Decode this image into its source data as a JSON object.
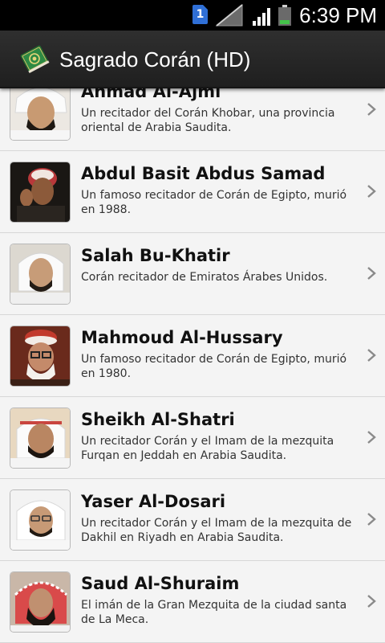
{
  "status_bar": {
    "sim_label": "1",
    "time": "6:39 PM"
  },
  "app_bar": {
    "title": "Sagrado Corán (HD)",
    "icon": "quran-book-icon"
  },
  "reciters": [
    {
      "name": "Ahmad Al-Ajmi",
      "description": "Un recitador del Corán Khobar, una provincia oriental de Arabia Saudita.",
      "avatar": "reciter-photo"
    },
    {
      "name": "Abdul Basit Abdus Samad",
      "description": "Un famoso recitador de Corán de Egipto, murió en 1988.",
      "avatar": "reciter-photo"
    },
    {
      "name": "Salah Bu-Khatir",
      "description": "Corán recitador de Emiratos Árabes Unidos.",
      "avatar": "reciter-photo"
    },
    {
      "name": "Mahmoud Al-Hussary",
      "description": "Un famoso recitador de Corán de Egipto, murió en 1980.",
      "avatar": "reciter-photo"
    },
    {
      "name": "Sheikh Al-Shatri",
      "description": "Un recitador Corán y el Imam de la mezquita Furqan en Jeddah en Arabia Saudita.",
      "avatar": "reciter-photo"
    },
    {
      "name": "Yaser Al-Dosari",
      "description": "Un recitador Corán y el Imam de la mezquita de Dakhil en Riyadh en Arabia Saudita.",
      "avatar": "reciter-photo"
    },
    {
      "name": "Saud Al-Shuraim",
      "description": "El imán de la Gran Mezquita de la ciudad santa de La Meca.",
      "avatar": "reciter-photo"
    }
  ],
  "colors": {
    "status_bar": "#000000",
    "action_bar": "#262626",
    "list_background": "#f4f4f4",
    "divider": "#d7d7d7",
    "chevron": "#8a8a8a"
  }
}
